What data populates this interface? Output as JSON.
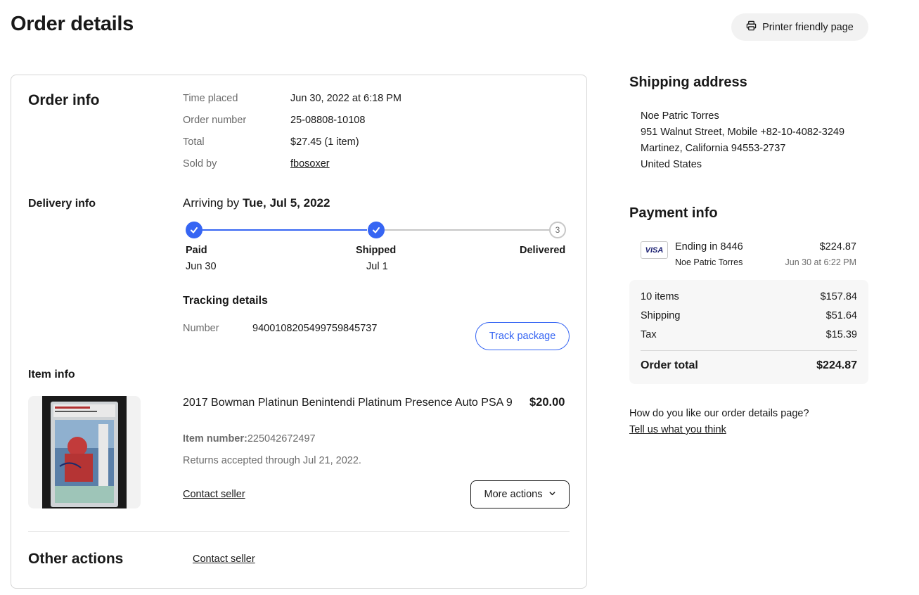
{
  "header": {
    "title": "Order details",
    "print_label": "Printer friendly page"
  },
  "order_info": {
    "heading": "Order info",
    "rows": [
      {
        "label": "Time placed",
        "value": "Jun 30, 2022 at 6:18 PM"
      },
      {
        "label": "Order number",
        "value": "25-08808-10108"
      },
      {
        "label": "Total",
        "value": "$27.45 (1 item)"
      },
      {
        "label": "Sold by",
        "value": "fbosoxer"
      }
    ]
  },
  "delivery": {
    "heading": "Delivery info",
    "arriving_prefix": "Arriving by ",
    "arriving_date": "Tue, Jul 5, 2022",
    "steps": [
      {
        "label": "Paid",
        "date": "Jun 30"
      },
      {
        "label": "Shipped",
        "date": "Jul 1"
      },
      {
        "label": "Delivered",
        "number": "3"
      }
    ],
    "tracking_heading": "Tracking details",
    "tracking_label": "Number",
    "tracking_number": "9400108205499759845737",
    "track_button": "Track package"
  },
  "item": {
    "heading": "Item info",
    "title": "2017 Bowman Platinun Benintendi Platinum Presence Auto PSA 9",
    "price": "$20.00",
    "item_number_label": "Item number:",
    "item_number": "225042672497",
    "returns": "Returns accepted through Jul 21, 2022.",
    "contact_seller": "Contact seller",
    "more_actions": "More actions"
  },
  "other_actions": {
    "heading": "Other actions",
    "contact_seller": "Contact seller"
  },
  "shipping": {
    "heading": "Shipping address",
    "lines": [
      "Noe Patric Torres",
      "951 Walnut Street, Mobile +82-10-4082-3249",
      "Martinez, California 94553-2737",
      "United States"
    ]
  },
  "payment": {
    "heading": "Payment info",
    "card_brand": "VISA",
    "card_ending": "Ending in 8446",
    "card_holder": "Noe Patric Torres",
    "amount": "$224.87",
    "date": "Jun 30 at 6:22 PM",
    "summary": [
      {
        "label": "10 items",
        "value": "$157.84"
      },
      {
        "label": "Shipping",
        "value": "$51.64"
      },
      {
        "label": "Tax",
        "value": "$15.39"
      }
    ],
    "total_label": "Order total",
    "total_value": "$224.87"
  },
  "feedback": {
    "question": "How do you like our order details page?",
    "link": "Tell us what you think"
  },
  "colors": {
    "accent_blue": "#3665f3",
    "text": "#191919",
    "muted": "#6b6b6b"
  }
}
